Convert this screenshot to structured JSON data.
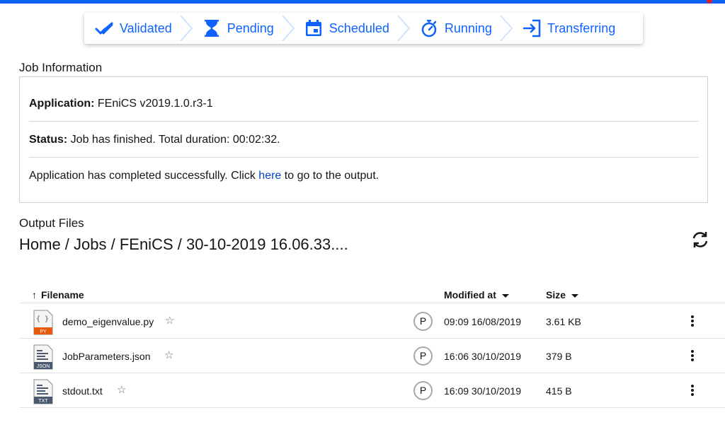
{
  "stepper": {
    "steps": [
      {
        "label": "Validated",
        "icon": "checkmark-icon"
      },
      {
        "label": "Pending",
        "icon": "hourglass-icon"
      },
      {
        "label": "Scheduled",
        "icon": "calendar-icon"
      },
      {
        "label": "Running",
        "icon": "stopwatch-icon"
      },
      {
        "label": "Transferring",
        "icon": "transfer-icon"
      }
    ],
    "accent": "#0f62fe"
  },
  "job_info": {
    "title": "Job Information",
    "application_label": "Application:",
    "application_value": " FEniCS v2019.1.0.r3-1",
    "status_label": "Status:",
    "status_value": " Job has finished. Total duration: 00:02:32.",
    "message_before": "Application has completed successfully. Click ",
    "message_link": "here",
    "message_after": " to go to the output."
  },
  "output": {
    "title": "Output Files",
    "breadcrumb": "Home / Jobs / FEniCS / 30-10-2019 16.06.33....",
    "refresh_icon": "refresh-icon"
  },
  "table": {
    "columns": {
      "filename": "Filename",
      "modified": "Modified at",
      "size": "Size"
    },
    "rows": [
      {
        "name": "demo_eigenvalue.py",
        "badge": "P",
        "modified": "09:09 16/08/2019",
        "size": "3.61 KB",
        "type": "PY",
        "type_color": "#e8590c"
      },
      {
        "name": "JobParameters.json",
        "badge": "P",
        "modified": "16:06 30/10/2019",
        "size": "379 B",
        "type": "JSON",
        "type_color": "#4a5a6e"
      },
      {
        "name": "stdout.txt",
        "badge": "P",
        "modified": "16:09 30/10/2019",
        "size": "415 B",
        "type": "TXT",
        "type_color": "#4a5a6e"
      }
    ]
  }
}
